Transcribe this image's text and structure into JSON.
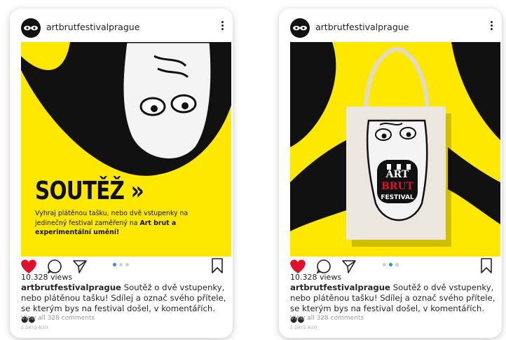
{
  "posts": [
    {
      "username": "artbrutfestivalprague",
      "contest_title": "SOUTĚŽ »",
      "contest_text_1": "Vyhraj plátěnou tašku, nebo dvě vstupenky na jedinečný festival zaměřený na ",
      "contest_text_bold": "Art brut a experimentální umění!",
      "views": "10.328 views",
      "caption_user": "artbrutfestivalprague",
      "caption_text": " Soutěž o dvě vstupenky, nebo plátěnou tašku! Sdílej a označ svého přítele, se kterým bys na festival došel, v komentářích. ●●",
      "comments": "View all 328 comments",
      "time_ago": "5 DAYS AGO",
      "active_slide": 1
    },
    {
      "username": "artbrutfestivalprague",
      "bag_text": [
        "ART",
        "BRUT",
        "FESTIVAL"
      ],
      "views": "10.328 views",
      "caption_user": "artbrutfestivalprague",
      "caption_text": " Soutěž o dvě vstupenky, nebo plátěnou tašku! Sdílej a označ svého přítele, se kterým bys na festival došel, v komentářích. ●●",
      "comments": "View all 328 comments",
      "time_ago": "5 DAYS AGO",
      "active_slide": 2
    }
  ],
  "colors": {
    "yellow": "#ffe800",
    "black": "#111111",
    "like_red": "#e0102a",
    "dot_active": "#2d8ef0",
    "dot_inactive": "#cfcfcf"
  },
  "icons": [
    "avatar-eyes-icon",
    "more-options-icon",
    "heart-icon",
    "comment-icon",
    "share-icon",
    "bookmark-icon"
  ]
}
